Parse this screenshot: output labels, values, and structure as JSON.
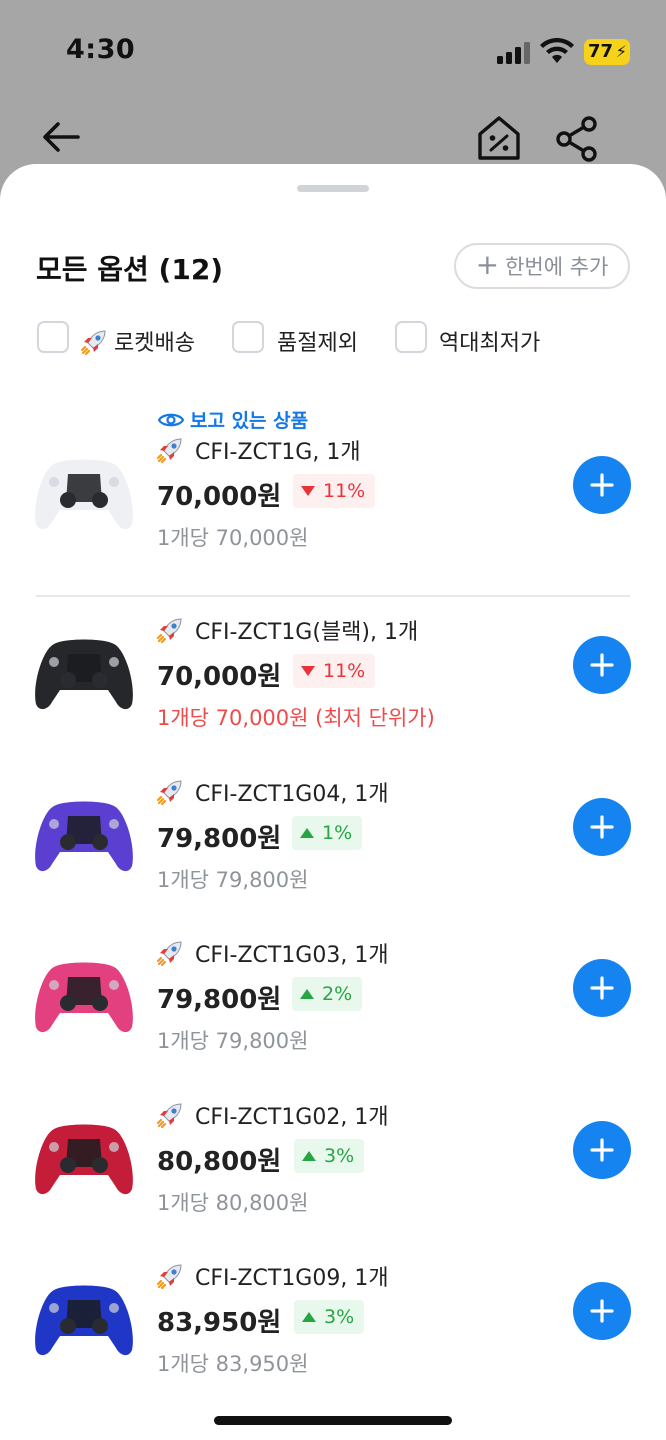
{
  "status_bar": {
    "time": "4:30",
    "battery": "77"
  },
  "sheet": {
    "title": "모든 옵션 (12)",
    "add_all_label": "한번에 추가",
    "filters": [
      {
        "label": "로켓배송",
        "rocket": true
      },
      {
        "label": "품절제외",
        "rocket": false
      },
      {
        "label": "역대최저가",
        "rocket": false
      }
    ],
    "viewing_label": "보고 있는 상품",
    "items": [
      {
        "name": "CFI-ZCT1G, 1개",
        "price": "70,000원",
        "change": "11%",
        "direction": "down",
        "unit_price": "1개당 70,000원",
        "color": "#eef0f4"
      },
      {
        "name": "CFI-ZCT1G(블랙), 1개",
        "price": "70,000원",
        "change": "11%",
        "direction": "down",
        "unit_price": "1개당 70,000원 (최저 단위가)",
        "color": "#26272b"
      },
      {
        "name": "CFI-ZCT1G04, 1개",
        "price": "79,800원",
        "change": "1%",
        "direction": "up",
        "unit_price": "1개당 79,800원",
        "color": "#5a3fd0"
      },
      {
        "name": "CFI-ZCT1G03, 1개",
        "price": "79,800원",
        "change": "2%",
        "direction": "up",
        "unit_price": "1개당 79,800원",
        "color": "#e2407f"
      },
      {
        "name": "CFI-ZCT1G02, 1개",
        "price": "80,800원",
        "change": "3%",
        "direction": "up",
        "unit_price": "1개당 80,800원",
        "color": "#c41d3a"
      },
      {
        "name": "CFI-ZCT1G09, 1개",
        "price": "83,950원",
        "change": "3%",
        "direction": "up",
        "unit_price": "1개당 83,950원",
        "color": "#2036c6"
      }
    ]
  },
  "colors": {
    "accent": "#1684f0",
    "down": "#e8333b",
    "up": "#27a544"
  }
}
